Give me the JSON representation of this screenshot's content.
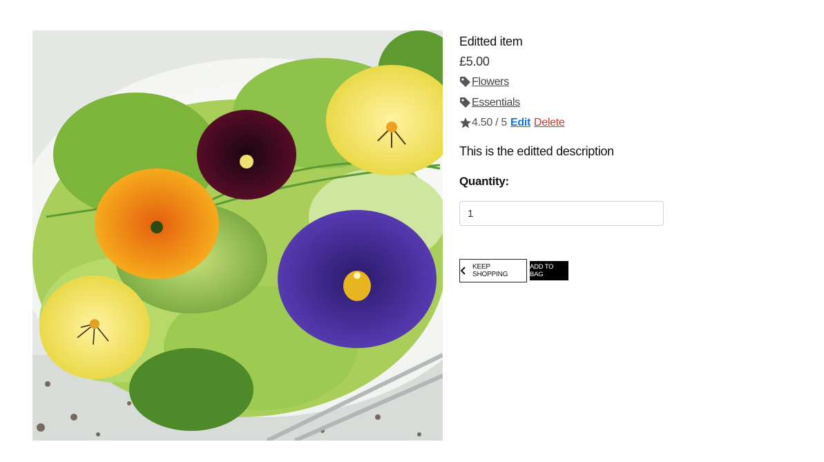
{
  "product": {
    "name": "Editted item",
    "price": "£5.00",
    "image_icon": "edible-flowers-salad-image",
    "categories": [
      {
        "label": "Flowers",
        "icon": "tag-icon"
      },
      {
        "label": "Essentials",
        "icon": "tag-icon"
      }
    ],
    "rating": {
      "text": "4.50 / 5",
      "value": 4.5,
      "max": 5,
      "icon": "star-icon"
    },
    "edit_label": "Edit",
    "delete_label": "Delete",
    "description": "This is the editted description"
  },
  "quantity": {
    "label": "Quantity:",
    "value": "1"
  },
  "buttons": {
    "keep_shopping": "KEEP SHOPPING",
    "keep_shopping_icon": "chevron-left-icon",
    "add_to_bag": "ADD TO BAG"
  },
  "colors": {
    "edit_link": "#1a6fd6",
    "delete_link": "#c0392b",
    "add_button_bg": "#000000"
  }
}
